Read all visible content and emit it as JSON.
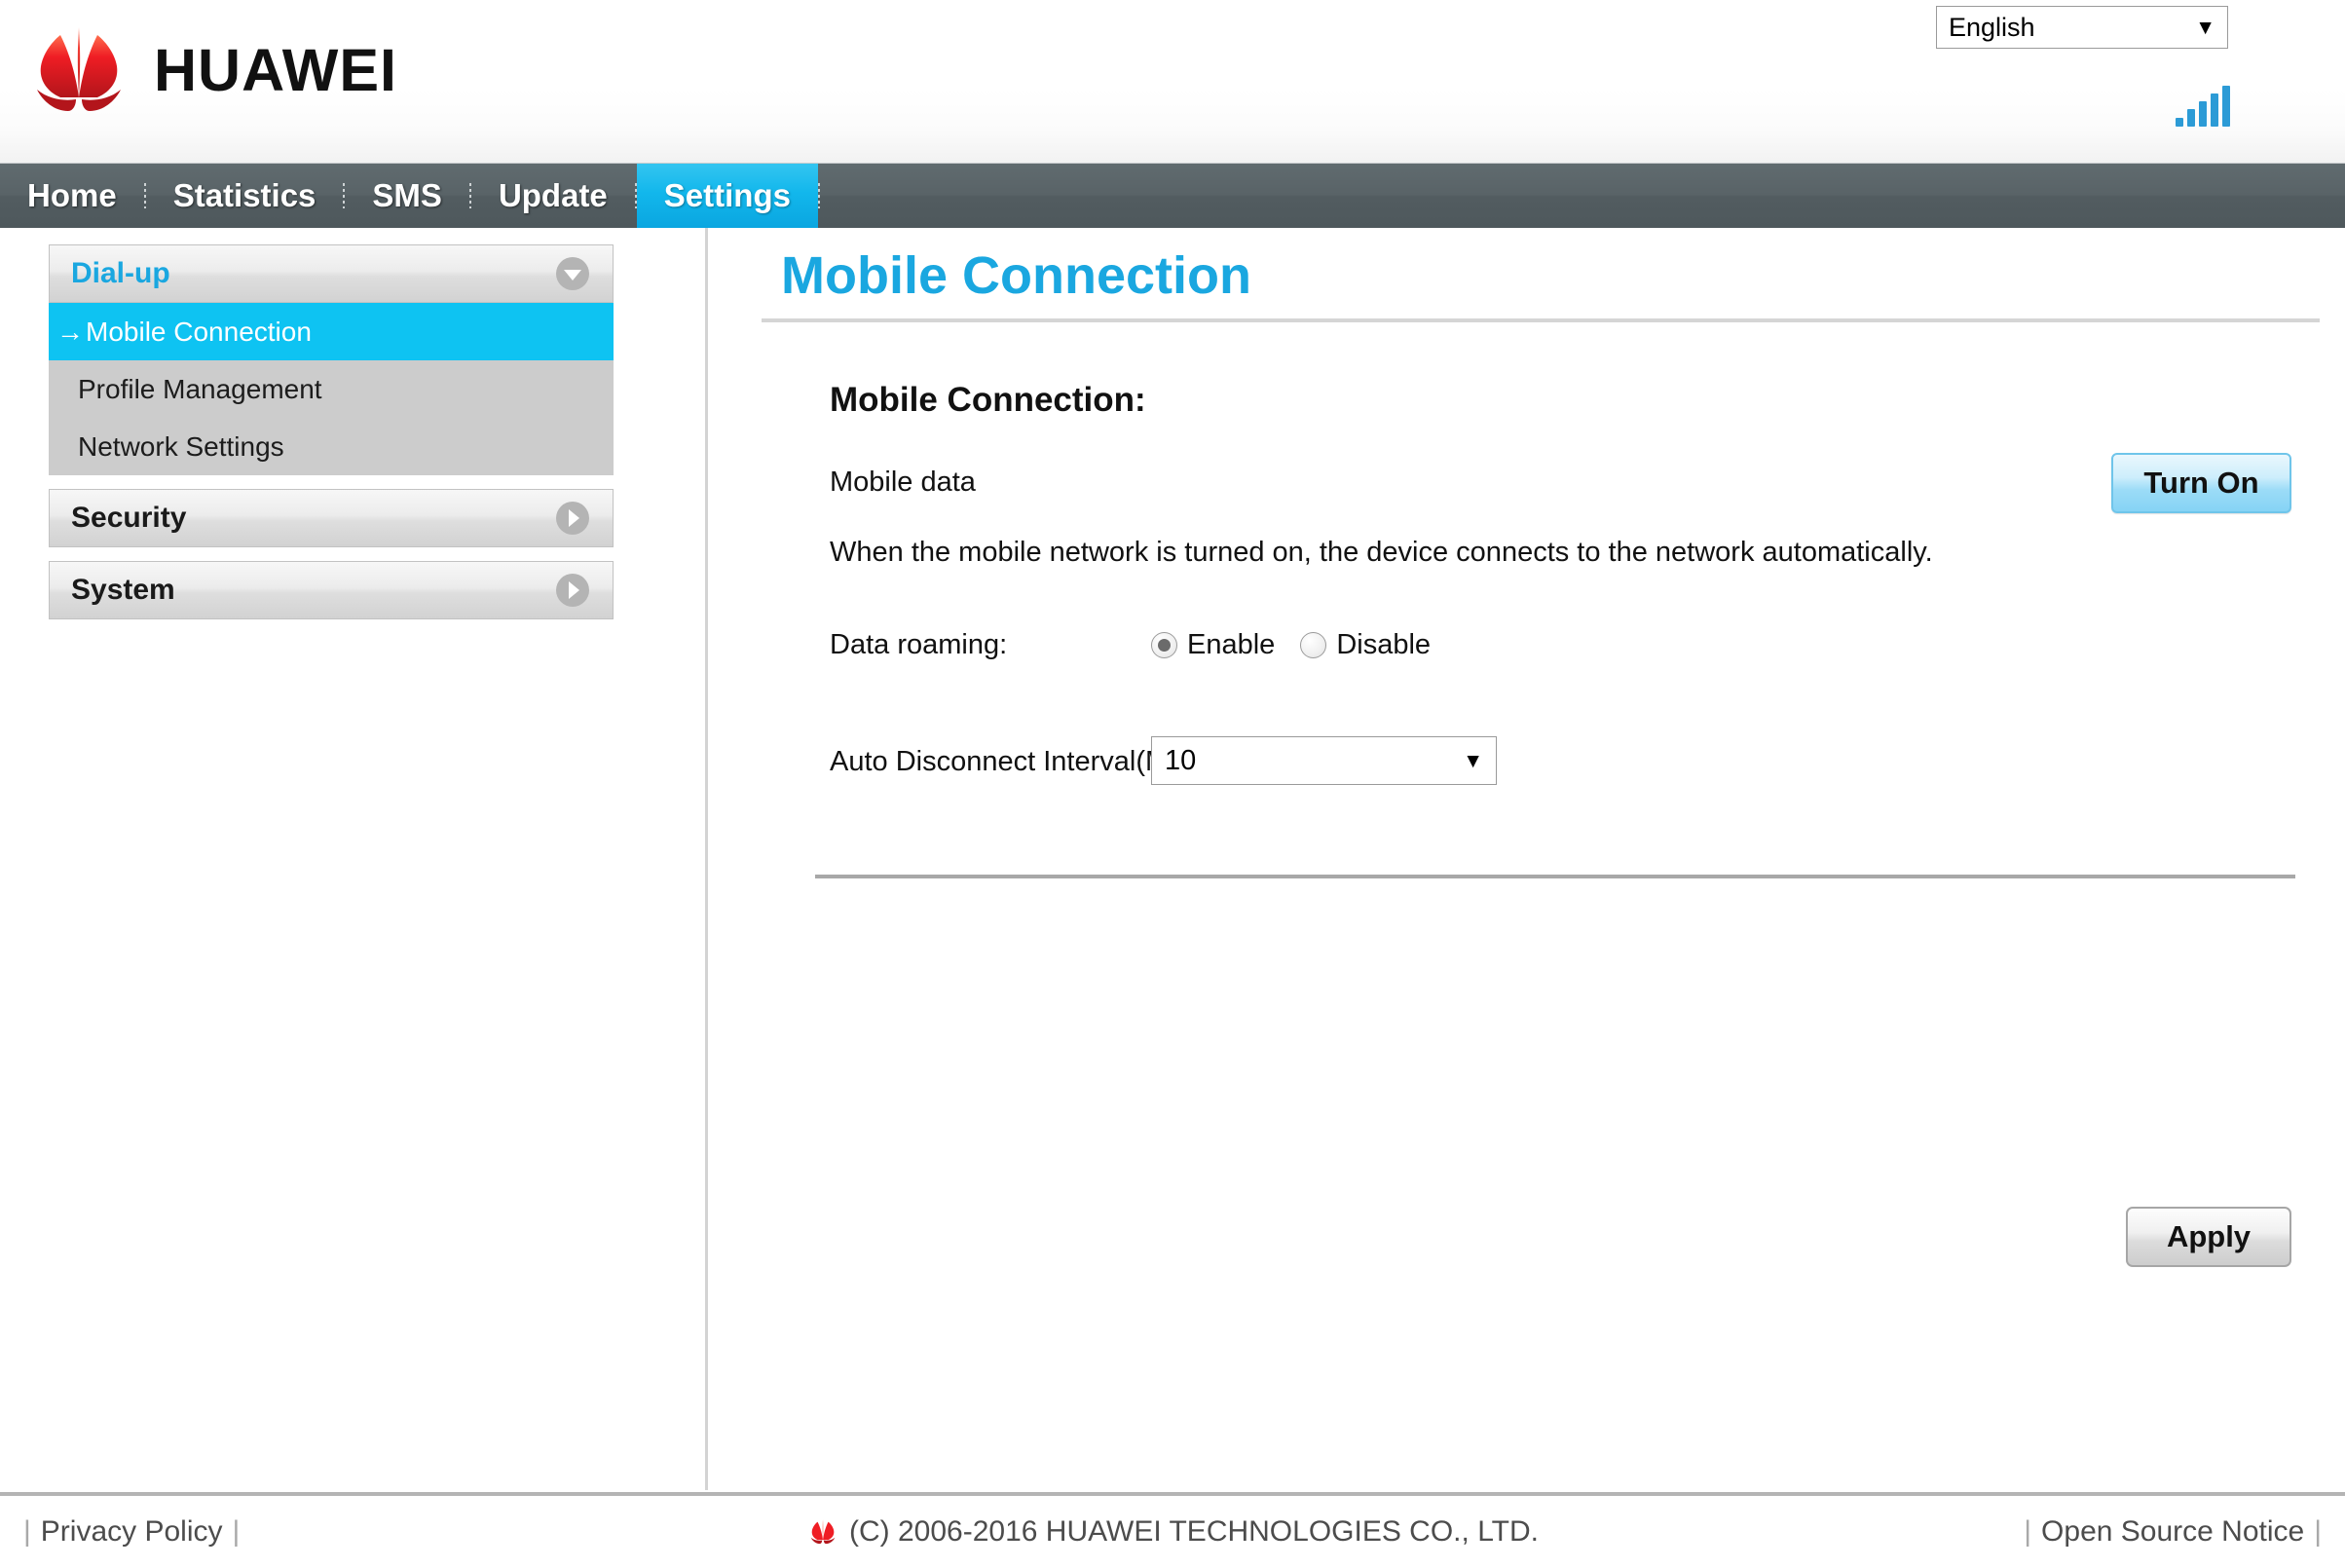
{
  "header": {
    "brand_text": "HUAWEI",
    "brand_logo_icon": "huawei-flower-logo",
    "language": {
      "selected": "English",
      "caret_icon": "chevron-down-icon"
    },
    "signal_icon": "signal-bars-icon",
    "signal_bars": 5,
    "accent_color": "#1aa7e0",
    "brand_red": "#e4002b"
  },
  "nav": {
    "items": [
      {
        "label": "Home",
        "active": false
      },
      {
        "label": "Statistics",
        "active": false
      },
      {
        "label": "SMS",
        "active": false
      },
      {
        "label": "Update",
        "active": false
      },
      {
        "label": "Settings",
        "active": true
      }
    ]
  },
  "sidebar": {
    "groups": [
      {
        "title": "Dial-up",
        "expanded": true,
        "icon": "chevron-down-circle-icon",
        "items": [
          {
            "label": "Mobile Connection",
            "selected": true,
            "marker": "→"
          },
          {
            "label": "Profile Management",
            "selected": false
          },
          {
            "label": "Network Settings",
            "selected": false
          }
        ]
      },
      {
        "title": "Security",
        "expanded": false,
        "icon": "chevron-right-circle-icon",
        "items": []
      },
      {
        "title": "System",
        "expanded": false,
        "icon": "chevron-right-circle-icon",
        "items": []
      }
    ]
  },
  "main": {
    "page_title": "Mobile Connection",
    "section_title": "Mobile Connection:",
    "mobile_data_label": "Mobile data",
    "turn_on_button": "Turn On",
    "description": "When the mobile network is turned on, the device connects to the network automatically.",
    "data_roaming": {
      "label": "Data roaming:",
      "options": [
        {
          "label": "Enable",
          "selected": true
        },
        {
          "label": "Disable",
          "selected": false
        }
      ]
    },
    "auto_disconnect": {
      "label": "Auto Disconnect Interval(Min):",
      "value": "10",
      "caret_icon": "chevron-down-icon"
    },
    "apply_button": "Apply"
  },
  "footer": {
    "privacy_policy": "Privacy Policy",
    "copyright": "(C) 2006-2016 HUAWEI TECHNOLOGIES CO., LTD.",
    "open_source_notice": "Open Source Notice",
    "logo_icon": "huawei-flower-logo-small"
  }
}
